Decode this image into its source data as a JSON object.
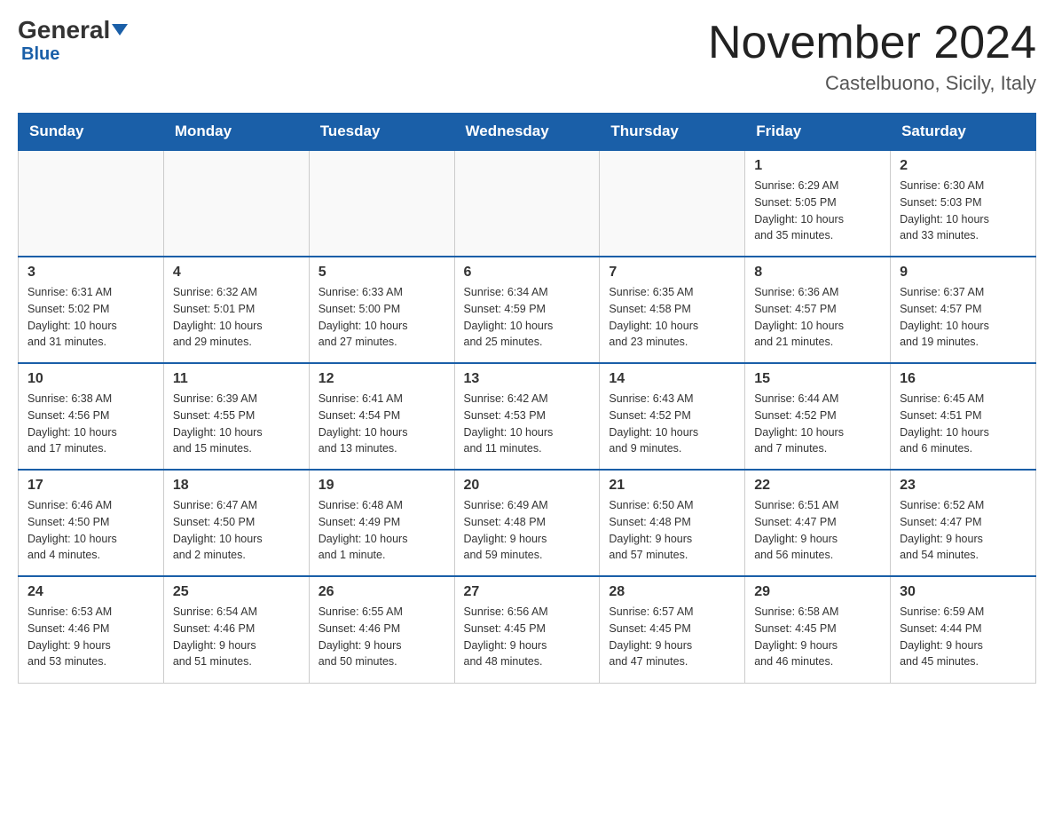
{
  "header": {
    "logo_general": "General",
    "logo_blue": "Blue",
    "month_title": "November 2024",
    "location": "Castelbuono, Sicily, Italy"
  },
  "days_of_week": [
    "Sunday",
    "Monday",
    "Tuesday",
    "Wednesday",
    "Thursday",
    "Friday",
    "Saturday"
  ],
  "weeks": [
    [
      {
        "day": "",
        "info": ""
      },
      {
        "day": "",
        "info": ""
      },
      {
        "day": "",
        "info": ""
      },
      {
        "day": "",
        "info": ""
      },
      {
        "day": "",
        "info": ""
      },
      {
        "day": "1",
        "info": "Sunrise: 6:29 AM\nSunset: 5:05 PM\nDaylight: 10 hours\nand 35 minutes."
      },
      {
        "day": "2",
        "info": "Sunrise: 6:30 AM\nSunset: 5:03 PM\nDaylight: 10 hours\nand 33 minutes."
      }
    ],
    [
      {
        "day": "3",
        "info": "Sunrise: 6:31 AM\nSunset: 5:02 PM\nDaylight: 10 hours\nand 31 minutes."
      },
      {
        "day": "4",
        "info": "Sunrise: 6:32 AM\nSunset: 5:01 PM\nDaylight: 10 hours\nand 29 minutes."
      },
      {
        "day": "5",
        "info": "Sunrise: 6:33 AM\nSunset: 5:00 PM\nDaylight: 10 hours\nand 27 minutes."
      },
      {
        "day": "6",
        "info": "Sunrise: 6:34 AM\nSunset: 4:59 PM\nDaylight: 10 hours\nand 25 minutes."
      },
      {
        "day": "7",
        "info": "Sunrise: 6:35 AM\nSunset: 4:58 PM\nDaylight: 10 hours\nand 23 minutes."
      },
      {
        "day": "8",
        "info": "Sunrise: 6:36 AM\nSunset: 4:57 PM\nDaylight: 10 hours\nand 21 minutes."
      },
      {
        "day": "9",
        "info": "Sunrise: 6:37 AM\nSunset: 4:57 PM\nDaylight: 10 hours\nand 19 minutes."
      }
    ],
    [
      {
        "day": "10",
        "info": "Sunrise: 6:38 AM\nSunset: 4:56 PM\nDaylight: 10 hours\nand 17 minutes."
      },
      {
        "day": "11",
        "info": "Sunrise: 6:39 AM\nSunset: 4:55 PM\nDaylight: 10 hours\nand 15 minutes."
      },
      {
        "day": "12",
        "info": "Sunrise: 6:41 AM\nSunset: 4:54 PM\nDaylight: 10 hours\nand 13 minutes."
      },
      {
        "day": "13",
        "info": "Sunrise: 6:42 AM\nSunset: 4:53 PM\nDaylight: 10 hours\nand 11 minutes."
      },
      {
        "day": "14",
        "info": "Sunrise: 6:43 AM\nSunset: 4:52 PM\nDaylight: 10 hours\nand 9 minutes."
      },
      {
        "day": "15",
        "info": "Sunrise: 6:44 AM\nSunset: 4:52 PM\nDaylight: 10 hours\nand 7 minutes."
      },
      {
        "day": "16",
        "info": "Sunrise: 6:45 AM\nSunset: 4:51 PM\nDaylight: 10 hours\nand 6 minutes."
      }
    ],
    [
      {
        "day": "17",
        "info": "Sunrise: 6:46 AM\nSunset: 4:50 PM\nDaylight: 10 hours\nand 4 minutes."
      },
      {
        "day": "18",
        "info": "Sunrise: 6:47 AM\nSunset: 4:50 PM\nDaylight: 10 hours\nand 2 minutes."
      },
      {
        "day": "19",
        "info": "Sunrise: 6:48 AM\nSunset: 4:49 PM\nDaylight: 10 hours\nand 1 minute."
      },
      {
        "day": "20",
        "info": "Sunrise: 6:49 AM\nSunset: 4:48 PM\nDaylight: 9 hours\nand 59 minutes."
      },
      {
        "day": "21",
        "info": "Sunrise: 6:50 AM\nSunset: 4:48 PM\nDaylight: 9 hours\nand 57 minutes."
      },
      {
        "day": "22",
        "info": "Sunrise: 6:51 AM\nSunset: 4:47 PM\nDaylight: 9 hours\nand 56 minutes."
      },
      {
        "day": "23",
        "info": "Sunrise: 6:52 AM\nSunset: 4:47 PM\nDaylight: 9 hours\nand 54 minutes."
      }
    ],
    [
      {
        "day": "24",
        "info": "Sunrise: 6:53 AM\nSunset: 4:46 PM\nDaylight: 9 hours\nand 53 minutes."
      },
      {
        "day": "25",
        "info": "Sunrise: 6:54 AM\nSunset: 4:46 PM\nDaylight: 9 hours\nand 51 minutes."
      },
      {
        "day": "26",
        "info": "Sunrise: 6:55 AM\nSunset: 4:46 PM\nDaylight: 9 hours\nand 50 minutes."
      },
      {
        "day": "27",
        "info": "Sunrise: 6:56 AM\nSunset: 4:45 PM\nDaylight: 9 hours\nand 48 minutes."
      },
      {
        "day": "28",
        "info": "Sunrise: 6:57 AM\nSunset: 4:45 PM\nDaylight: 9 hours\nand 47 minutes."
      },
      {
        "day": "29",
        "info": "Sunrise: 6:58 AM\nSunset: 4:45 PM\nDaylight: 9 hours\nand 46 minutes."
      },
      {
        "day": "30",
        "info": "Sunrise: 6:59 AM\nSunset: 4:44 PM\nDaylight: 9 hours\nand 45 minutes."
      }
    ]
  ]
}
